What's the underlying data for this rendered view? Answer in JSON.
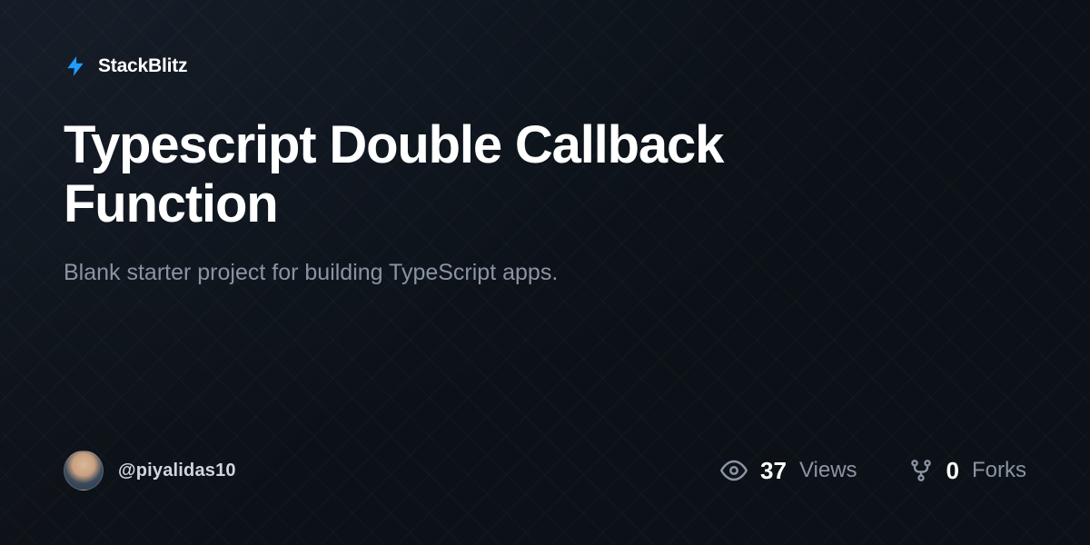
{
  "brand": {
    "name": "StackBlitz"
  },
  "project": {
    "title": "Typescript Double Callback Function",
    "description": "Blank starter project for building TypeScript apps."
  },
  "author": {
    "handle": "@piyalidas10"
  },
  "stats": {
    "views": {
      "count": "37",
      "label": "Views"
    },
    "forks": {
      "count": "0",
      "label": "Forks"
    }
  }
}
